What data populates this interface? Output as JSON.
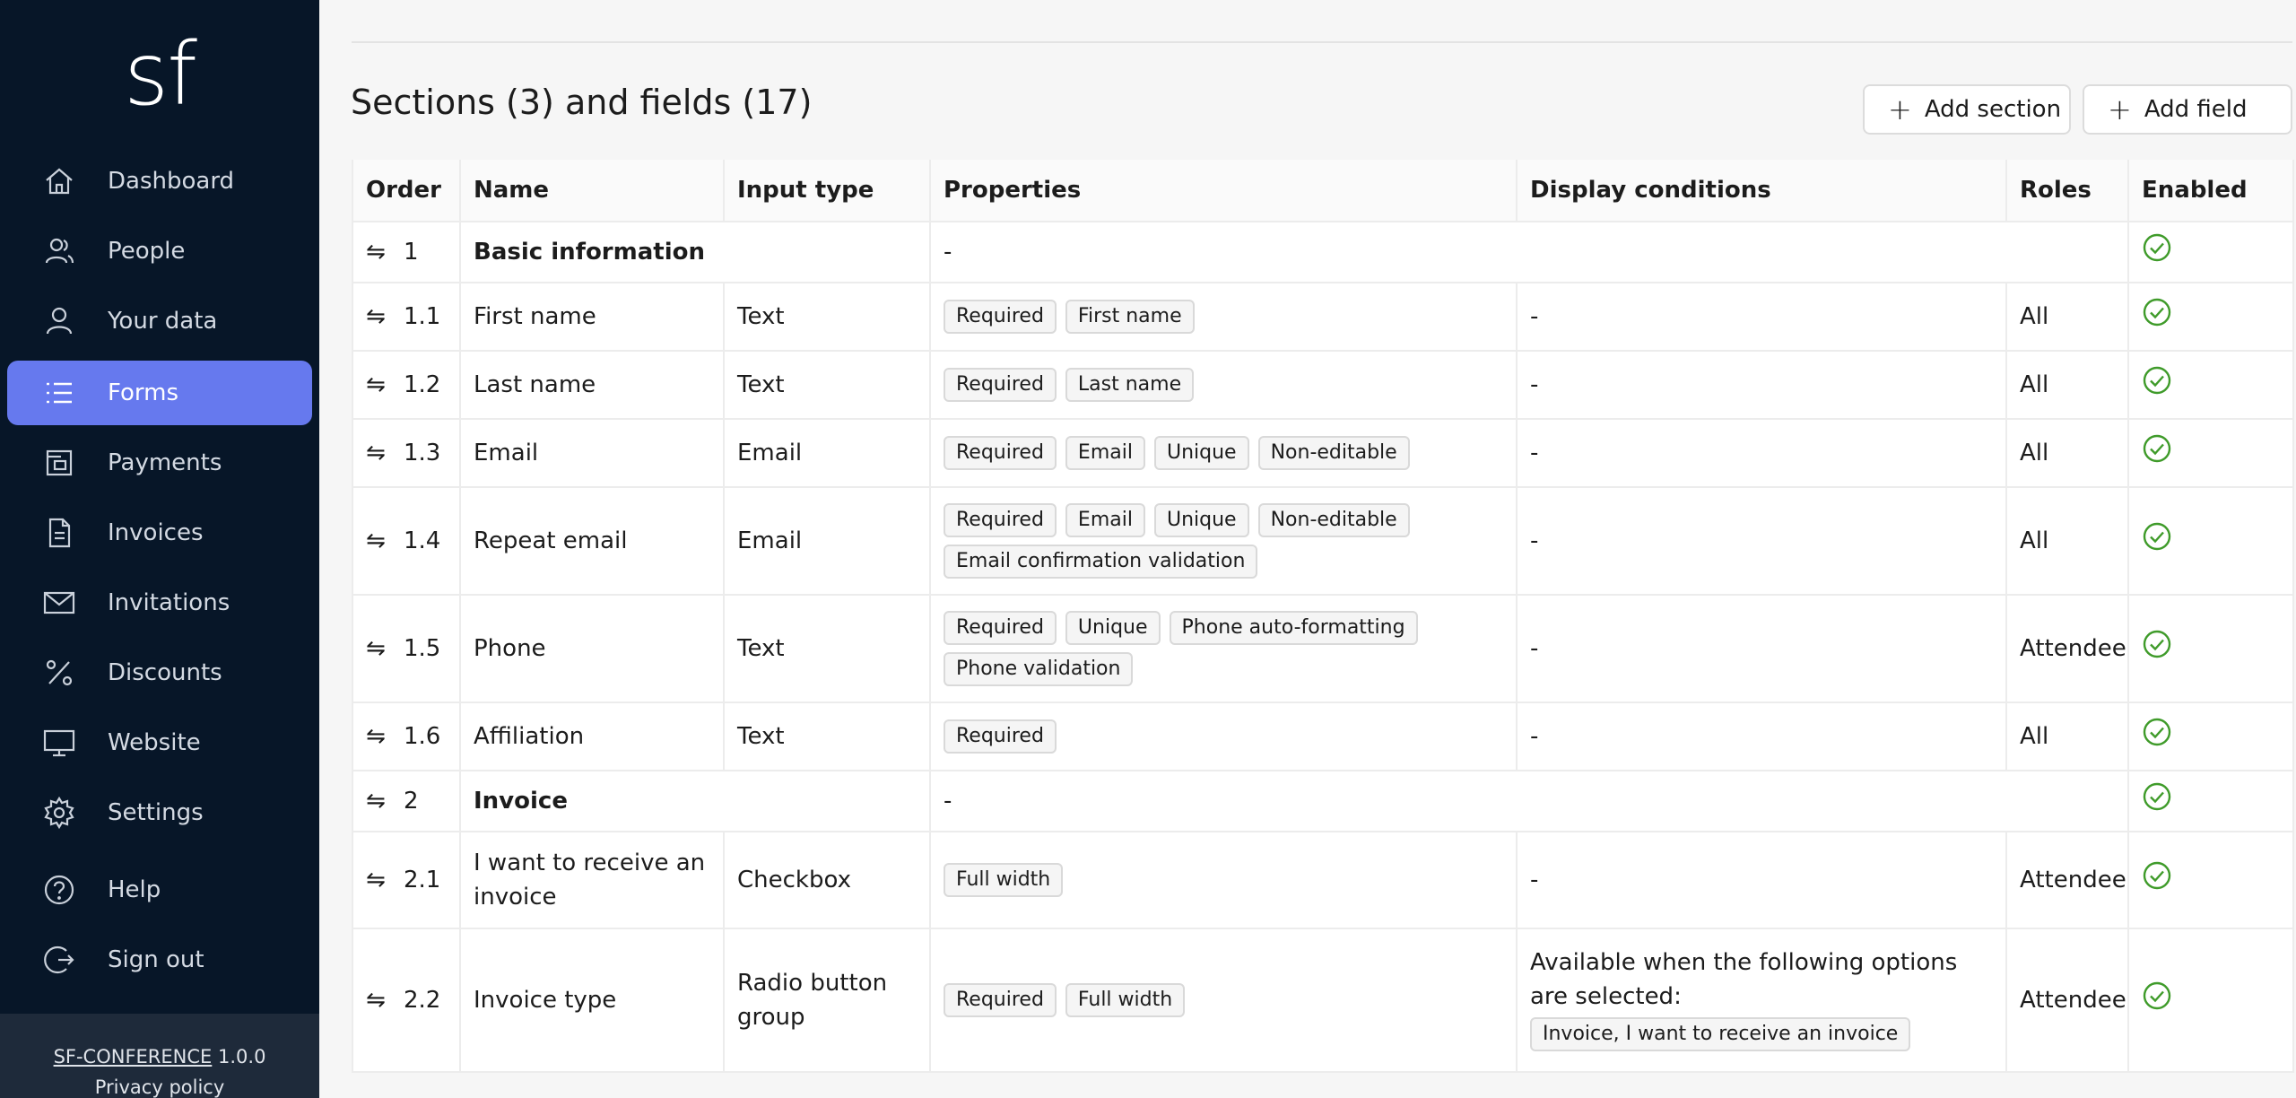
{
  "sidebar": {
    "logo": "sf",
    "items": [
      {
        "label": "Dashboard",
        "icon": "home-icon",
        "active": false
      },
      {
        "label": "People",
        "icon": "people-icon",
        "active": false
      },
      {
        "label": "Your data",
        "icon": "user-icon",
        "active": false
      },
      {
        "label": "Forms",
        "icon": "list-icon",
        "active": true
      },
      {
        "label": "Payments",
        "icon": "wallet-icon",
        "active": false
      },
      {
        "label": "Invoices",
        "icon": "document-icon",
        "active": false
      },
      {
        "label": "Invitations",
        "icon": "envelope-icon",
        "active": false
      },
      {
        "label": "Discounts",
        "icon": "percent-icon",
        "active": false
      },
      {
        "label": "Website",
        "icon": "monitor-icon",
        "active": false
      },
      {
        "label": "Settings",
        "icon": "gear-icon",
        "active": false
      },
      {
        "label": "Help",
        "icon": "help-icon",
        "active": false
      },
      {
        "label": "Sign out",
        "icon": "sign-out-icon",
        "active": false
      }
    ],
    "footer": {
      "brand": "SF-CONFERENCE",
      "version": "1.0.0",
      "privacy": "Privacy policy"
    }
  },
  "header": {
    "title": "Sections (3) and fields (17)",
    "add_section": "Add section",
    "add_field": "Add field"
  },
  "table": {
    "columns": [
      "Order",
      "Name",
      "Input type",
      "Properties",
      "Display conditions",
      "Roles",
      "Enabled"
    ],
    "rows": [
      {
        "kind": "section",
        "order": "1",
        "name": "Basic information",
        "properties": "-"
      },
      {
        "kind": "field",
        "order": "1.1",
        "name": "First name",
        "input_type": "Text",
        "tags": [
          "Required",
          "First name"
        ],
        "condition": "-",
        "roles": "All"
      },
      {
        "kind": "field",
        "order": "1.2",
        "name": "Last name",
        "input_type": "Text",
        "tags": [
          "Required",
          "Last name"
        ],
        "condition": "-",
        "roles": "All"
      },
      {
        "kind": "field",
        "order": "1.3",
        "name": "Email",
        "input_type": "Email",
        "tags": [
          "Required",
          "Email",
          "Unique",
          "Non-editable"
        ],
        "condition": "-",
        "roles": "All"
      },
      {
        "kind": "field",
        "order": "1.4",
        "name": "Repeat email",
        "input_type": "Email",
        "tags": [
          "Required",
          "Email",
          "Unique",
          "Non-editable",
          "Email confirmation validation"
        ],
        "condition": "-",
        "roles": "All"
      },
      {
        "kind": "field",
        "order": "1.5",
        "name": "Phone",
        "input_type": "Text",
        "tags": [
          "Required",
          "Unique",
          "Phone auto-formatting",
          "Phone validation"
        ],
        "condition": "-",
        "roles": "Attendee"
      },
      {
        "kind": "field",
        "order": "1.6",
        "name": "Affiliation",
        "input_type": "Text",
        "tags": [
          "Required"
        ],
        "condition": "-",
        "roles": "All"
      },
      {
        "kind": "section",
        "order": "2",
        "name": "Invoice",
        "properties": "-"
      },
      {
        "kind": "field",
        "order": "2.1",
        "name": "I want to receive an invoice",
        "input_type": "Checkbox",
        "tags": [
          "Full width"
        ],
        "condition": "-",
        "roles": "Attendee"
      },
      {
        "kind": "field",
        "order": "2.2",
        "name": "Invoice type",
        "input_type": "Radio button group",
        "tags": [
          "Required",
          "Full width"
        ],
        "condition": "Available when the following options are selected:",
        "condition_tags": [
          "Invoice, I want to receive an invoice"
        ],
        "roles": "Attendee"
      }
    ]
  },
  "colors": {
    "sidebar_bg": "#071628",
    "active": "#6679ee",
    "check": "#3f9b2a"
  }
}
